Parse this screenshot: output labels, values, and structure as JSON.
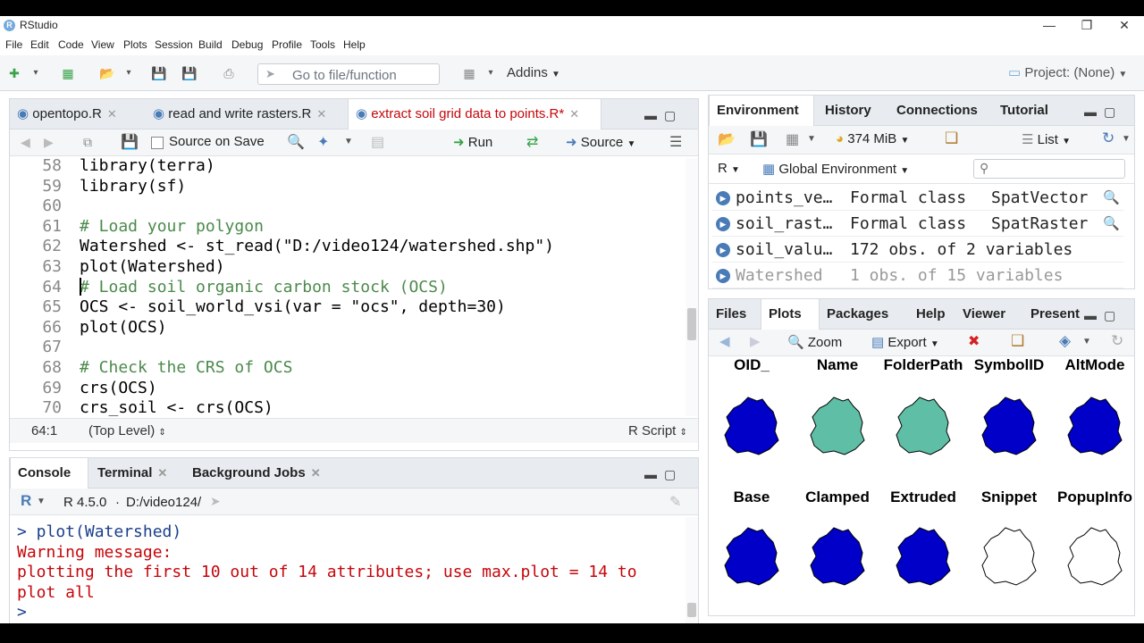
{
  "window": {
    "title": "RStudio"
  },
  "menu": [
    "File",
    "Edit",
    "Code",
    "View",
    "Plots",
    "Session",
    "Build",
    "Debug",
    "Profile",
    "Tools",
    "Help"
  ],
  "toolbar": {
    "goto_placeholder": "Go to file/function",
    "addins": "Addins",
    "project": "Project: (None)"
  },
  "editor": {
    "tabs": [
      {
        "label": "opentopo.R"
      },
      {
        "label": "read and write rasters.R"
      },
      {
        "label": "extract soil grid data to points.R*"
      }
    ],
    "source_on_save": "Source on Save",
    "run_label": "Run",
    "source_label": "Source",
    "lines": [
      {
        "num": "58",
        "text": "library(terra)"
      },
      {
        "num": "59",
        "text": "library(sf)"
      },
      {
        "num": "60",
        "text": ""
      },
      {
        "num": "61",
        "text": "# Load your polygon"
      },
      {
        "num": "62",
        "text": "Watershed <- st_read(\"D:/video124/watershed.shp\")"
      },
      {
        "num": "63",
        "text": "plot(Watershed)"
      },
      {
        "num": "64",
        "text": "# Load soil organic carbon stock (OCS)"
      },
      {
        "num": "65",
        "text": "OCS <- soil_world_vsi(var = \"ocs\", depth=30)"
      },
      {
        "num": "66",
        "text": "plot(OCS)"
      },
      {
        "num": "67",
        "text": ""
      },
      {
        "num": "68",
        "text": "# Check the CRS of OCS"
      },
      {
        "num": "69",
        "text": "crs(OCS)"
      },
      {
        "num": "70",
        "text": "crs_soil <- crs(OCS)"
      }
    ],
    "status_pos": "64:1",
    "status_level": "(Top Level)",
    "status_type": "R Script"
  },
  "console": {
    "tabs": [
      "Console",
      "Terminal",
      "Background Jobs"
    ],
    "r_version": "R 4.5.0",
    "path": "D:/video124/",
    "lines": [
      {
        "text": "> plot(Watershed)",
        "kind": "cmd"
      },
      {
        "text": "Warning message:",
        "kind": "err"
      },
      {
        "text": "plotting the first 10 out of 14 attributes; use max.plot = 14 to plot all",
        "kind": "err"
      },
      {
        "text": "> ",
        "kind": "cmd"
      }
    ]
  },
  "environment": {
    "tabs": [
      "Environment",
      "History",
      "Connections",
      "Tutorial"
    ],
    "memory": "374 MiB",
    "view_mode": "List",
    "language": "R",
    "scope": "Global Environment",
    "rows": [
      {
        "name": "points_ve…",
        "val": "Formal class",
        "val2": "SpatVector"
      },
      {
        "name": "soil_rast…",
        "val": "Formal class",
        "val2": "SpatRaster"
      },
      {
        "name": "soil_valu…",
        "val": "172 obs. of 2 variables",
        "val2": ""
      },
      {
        "name": "Watershed",
        "val": "1 obs. of 15 variables",
        "val2": ""
      }
    ]
  },
  "plots": {
    "tabs": [
      "Files",
      "Plots",
      "Packages",
      "Help",
      "Viewer",
      "Present"
    ],
    "zoom": "Zoom",
    "export": "Export",
    "row1": [
      "OID_",
      "Name",
      "FolderPath",
      "SymbolID",
      "AltMode"
    ],
    "row2": [
      "Base",
      "Clamped",
      "Extruded",
      "Snippet",
      "PopupInfo"
    ],
    "colors": {
      "blue": "#0000c8",
      "teal": "#5fbfa6",
      "white": "#ffffff"
    }
  }
}
